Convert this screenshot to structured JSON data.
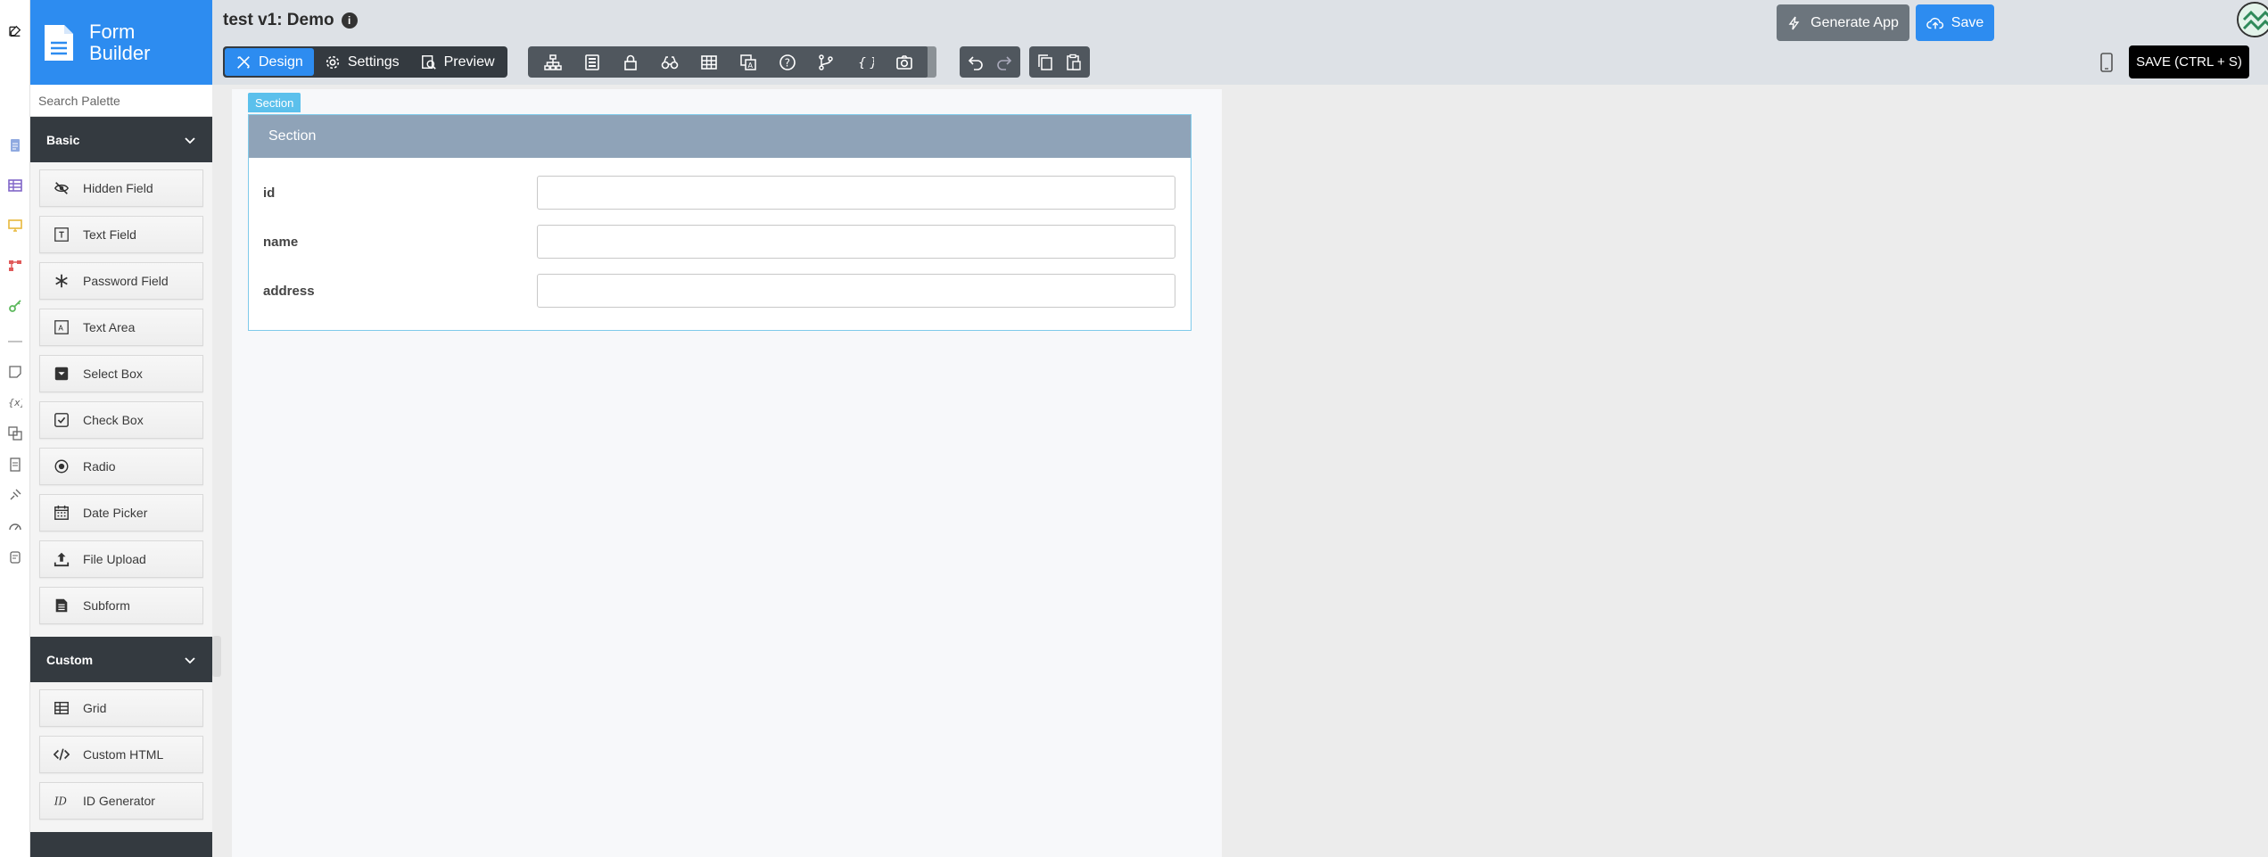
{
  "brand": {
    "title_line1": "Form",
    "title_line2": "Builder",
    "color": "#2d8cf0"
  },
  "app": {
    "title": "test v1: Demo",
    "info_glyph": "i"
  },
  "modes": [
    {
      "label": "Design",
      "icon": "design-icon",
      "active": true
    },
    {
      "label": "Settings",
      "icon": "gear-icon",
      "active": false
    },
    {
      "label": "Preview",
      "icon": "preview-icon",
      "active": false
    }
  ],
  "toolbar_icons": [
    "sitemap-icon",
    "form-icon",
    "lock-icon",
    "binoculars-icon",
    "table-icon",
    "translate-icon",
    "help-icon",
    "branch-icon",
    "braces-icon",
    "camera-icon"
  ],
  "history_icons": [
    "undo-icon",
    "redo-icon"
  ],
  "clipboard_icons": [
    "copy-icon",
    "paste-icon"
  ],
  "actions": {
    "generate": "Generate App",
    "save": "Save",
    "save_tooltip": "SAVE (CTRL + S)"
  },
  "palette": {
    "search_placeholder": "Search Palette",
    "groups": [
      {
        "name": "Basic",
        "items": [
          {
            "label": "Hidden Field",
            "icon": "eye-slash-icon"
          },
          {
            "label": "Text Field",
            "icon": "text-field-icon"
          },
          {
            "label": "Password Field",
            "icon": "asterisk-icon"
          },
          {
            "label": "Text Area",
            "icon": "text-area-icon"
          },
          {
            "label": "Select Box",
            "icon": "select-box-icon"
          },
          {
            "label": "Check Box",
            "icon": "checkbox-icon"
          },
          {
            "label": "Radio",
            "icon": "radio-icon"
          },
          {
            "label": "Date Picker",
            "icon": "calendar-icon"
          },
          {
            "label": "File Upload",
            "icon": "upload-icon"
          },
          {
            "label": "Subform",
            "icon": "subform-icon"
          }
        ]
      },
      {
        "name": "Custom",
        "items": [
          {
            "label": "Grid",
            "icon": "grid-icon"
          },
          {
            "label": "Custom HTML",
            "icon": "code-icon"
          },
          {
            "label": "ID Generator",
            "icon": "id-icon"
          }
        ]
      }
    ]
  },
  "form": {
    "section_tag": "Section",
    "section_title": "Section",
    "fields": [
      {
        "label": "id",
        "value": ""
      },
      {
        "label": "name",
        "value": ""
      },
      {
        "label": "address",
        "value": ""
      }
    ]
  }
}
